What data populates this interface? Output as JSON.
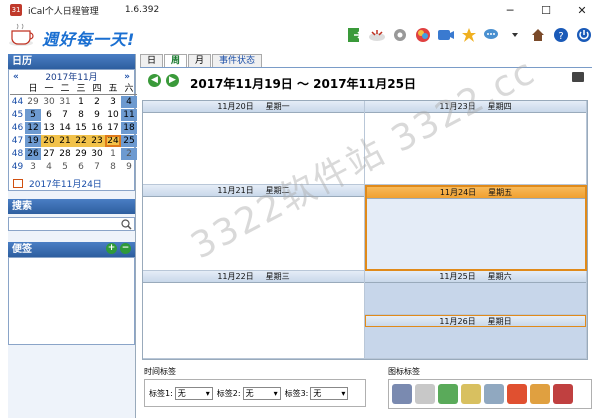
{
  "window": {
    "title": "iCal个人日程管理",
    "version": "1.6.392",
    "min": "─",
    "max": "☐",
    "close": "✕"
  },
  "banner": {
    "logo_text": "週好每一天!"
  },
  "left": {
    "calendar_header": "日历",
    "month_label": "2017年11月",
    "prev": "«",
    "next": "»",
    "weekday_headers": [
      "一",
      "二",
      "三",
      "四",
      "五",
      "六"
    ],
    "weekday_first": "日",
    "rows": [
      {
        "wk": "44",
        "days": [
          "29",
          "30",
          "31",
          "1",
          "2",
          "3",
          "4"
        ]
      },
      {
        "wk": "45",
        "days": [
          "5",
          "6",
          "7",
          "8",
          "9",
          "10",
          "11"
        ]
      },
      {
        "wk": "46",
        "days": [
          "12",
          "13",
          "14",
          "15",
          "16",
          "17",
          "18"
        ]
      },
      {
        "wk": "47",
        "days": [
          "19",
          "20",
          "21",
          "22",
          "23",
          "24",
          "25"
        ]
      },
      {
        "wk": "48",
        "days": [
          "26",
          "27",
          "28",
          "29",
          "30",
          "1",
          "2"
        ]
      },
      {
        "wk": "49",
        "days": [
          "3",
          "4",
          "5",
          "6",
          "7",
          "8",
          "9"
        ]
      }
    ],
    "today_label": "2017年11月24日",
    "search_header": "搜索",
    "notes_header": "便签",
    "note_add": "+",
    "note_remove": "−"
  },
  "main": {
    "tabs": [
      "日",
      "周",
      "月",
      "事件状态"
    ],
    "active_tab": "周",
    "range_text": "2017年11月19日 ～ 2017年11月25日",
    "days": [
      {
        "date": "11月20日",
        "wd": "星期一"
      },
      {
        "date": "11月23日",
        "wd": "星期四"
      },
      {
        "date": "11月21日",
        "wd": "星期二"
      },
      {
        "date": "11月24日",
        "wd": "星期五"
      },
      {
        "date": "11月22日",
        "wd": "星期三"
      },
      {
        "date": "11月25日",
        "wd": "星期六"
      },
      {
        "date": "11月26日",
        "wd": "星期日"
      }
    ]
  },
  "bottom": {
    "time_tags_label": "时间标签",
    "tag1_label": "标签1:",
    "tag2_label": "标签2:",
    "tag3_label": "标签3:",
    "tag1_value": "无",
    "tag2_value": "无",
    "tag3_value": "无",
    "icon_tags_label": "图标标签"
  },
  "watermark": "3322软件站 3322.cc",
  "colors": {
    "accent": "#2d5e9f",
    "current_day": "#f0a030",
    "weekend": "#c7d6ea"
  }
}
